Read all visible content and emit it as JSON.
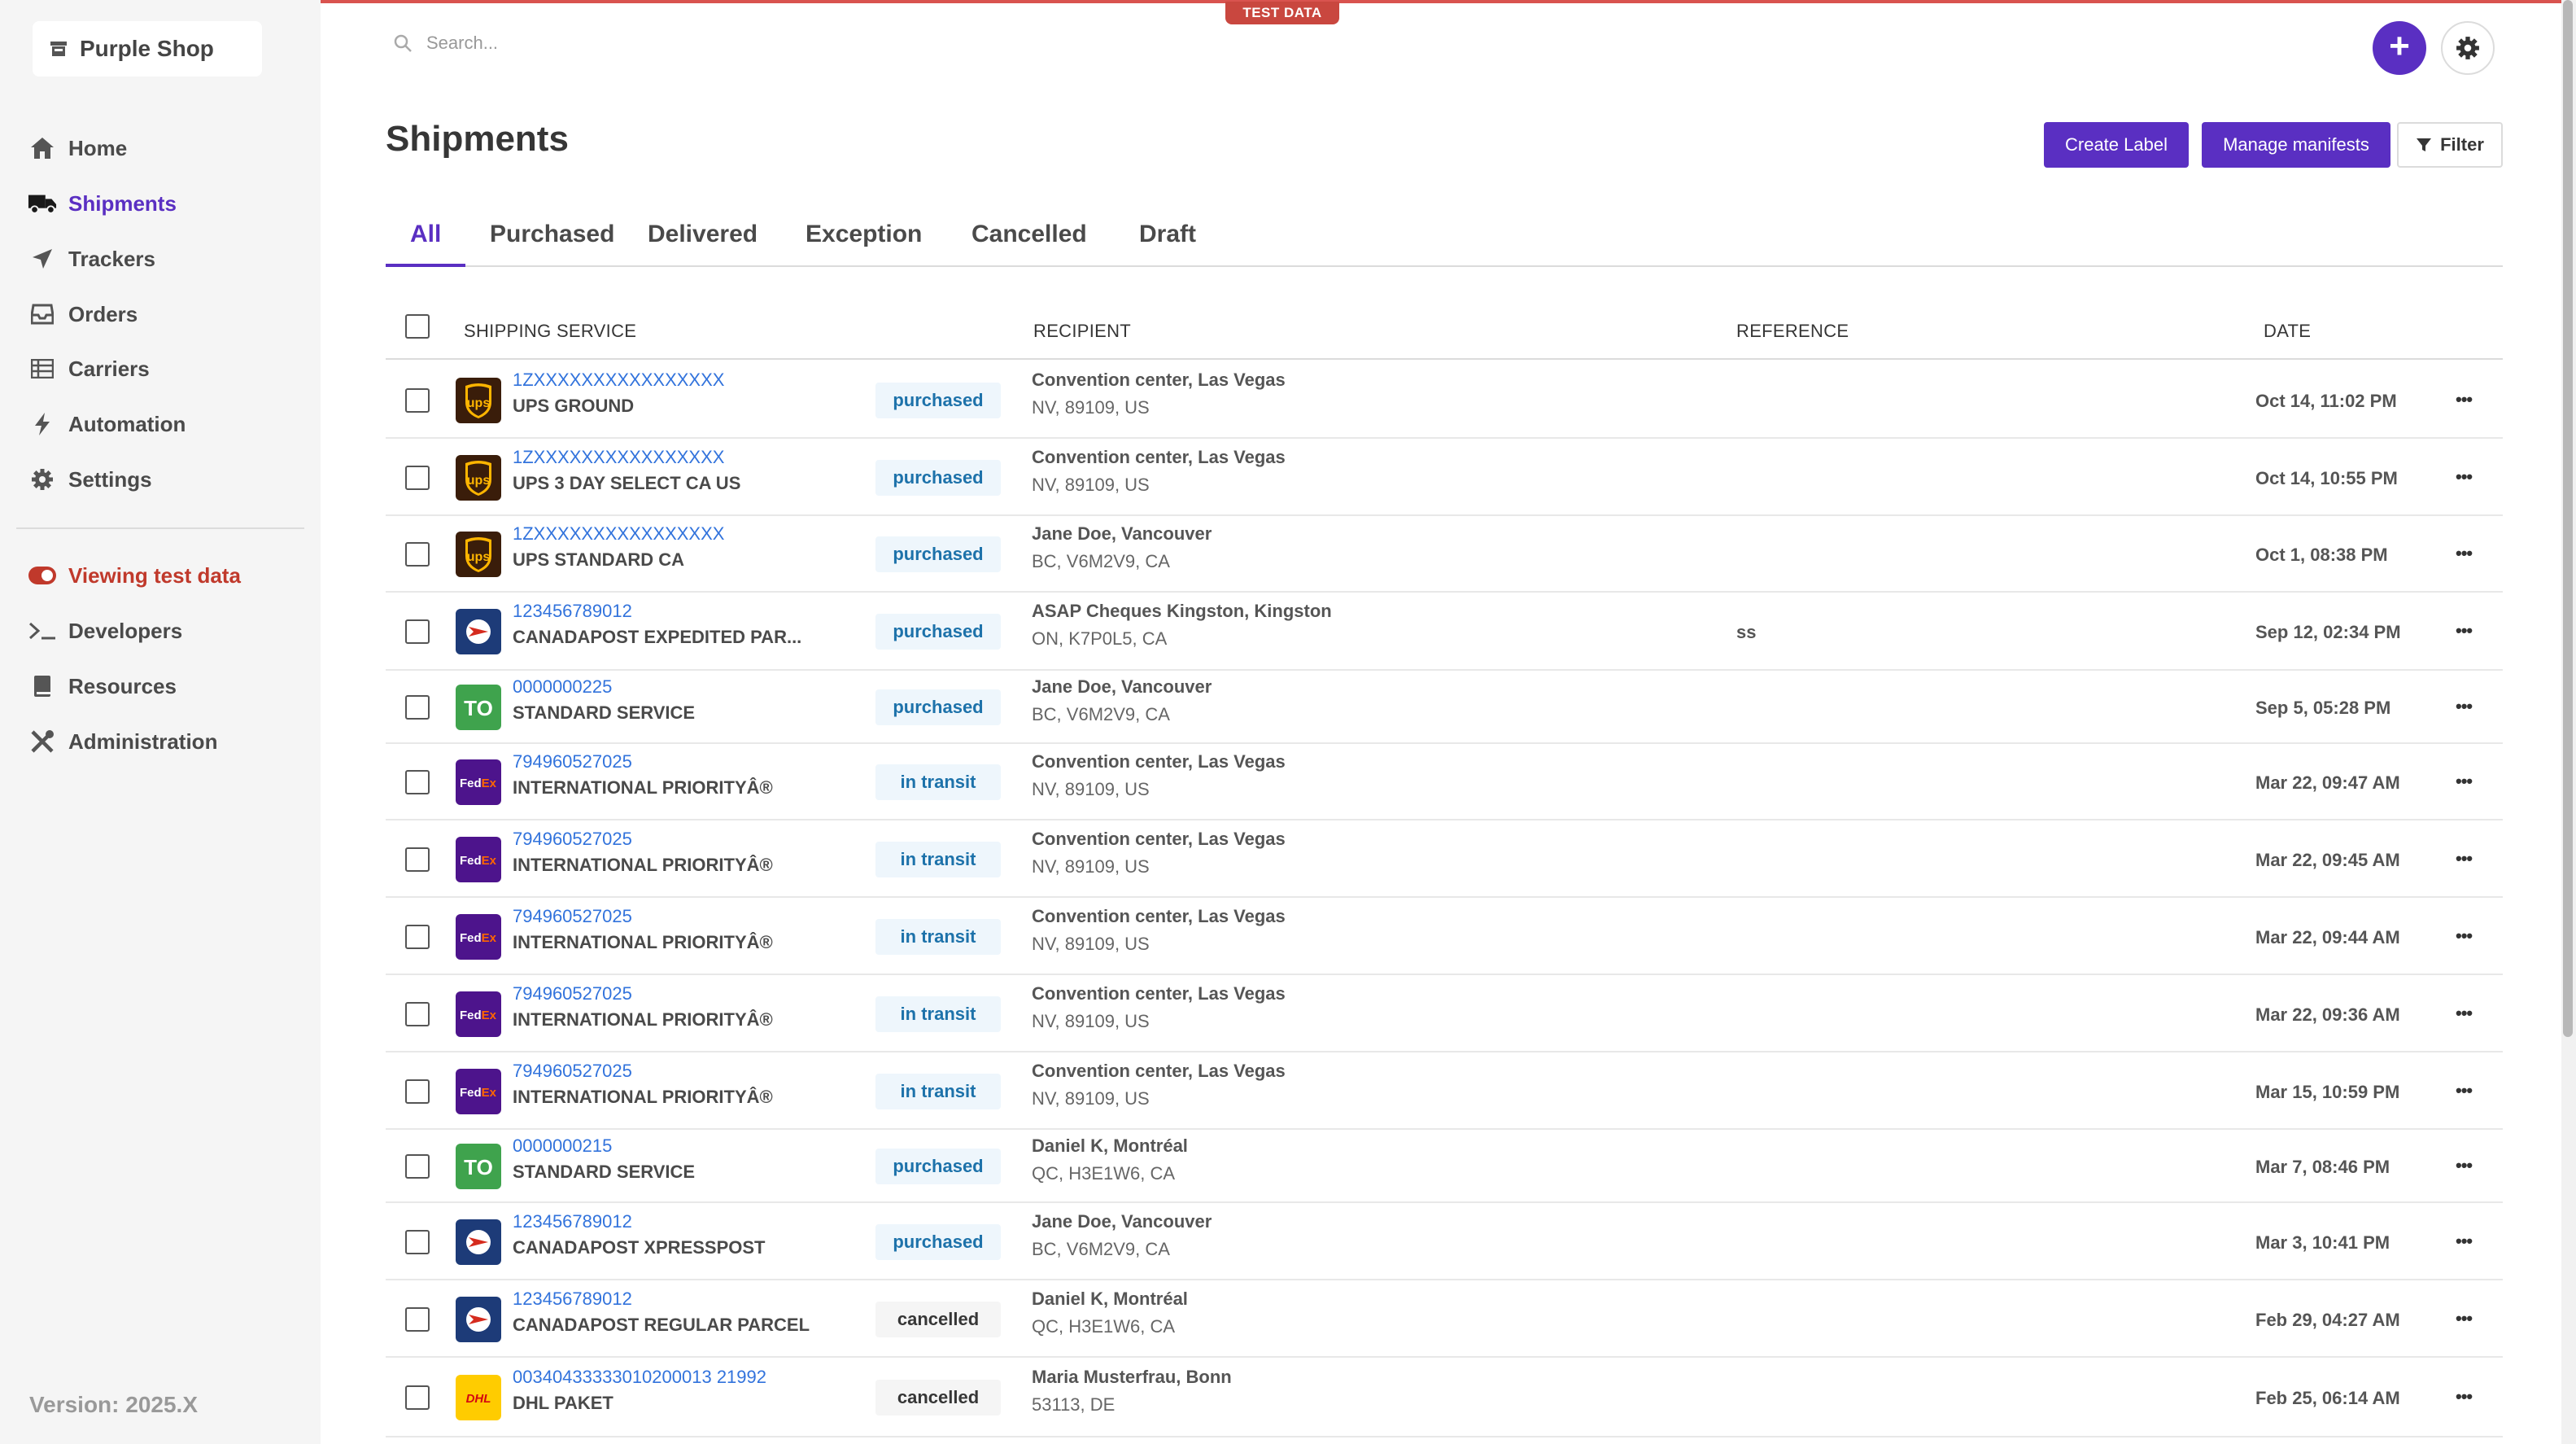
{
  "banner": {
    "test_badge": "TEST DATA"
  },
  "sidebar": {
    "shop_name": "Purple Shop",
    "items": [
      {
        "label": "Home",
        "icon": "home-icon"
      },
      {
        "label": "Shipments",
        "icon": "truck-icon",
        "active": true
      },
      {
        "label": "Trackers",
        "icon": "send-icon"
      },
      {
        "label": "Orders",
        "icon": "inbox-icon"
      },
      {
        "label": "Carriers",
        "icon": "list-icon"
      },
      {
        "label": "Automation",
        "icon": "bolt-icon"
      },
      {
        "label": "Settings",
        "icon": "gear-icon"
      }
    ],
    "test_mode_label": "Viewing test data",
    "items2": [
      {
        "label": "Developers",
        "icon": "terminal-icon"
      },
      {
        "label": "Resources",
        "icon": "book-icon"
      },
      {
        "label": "Administration",
        "icon": "tools-icon"
      }
    ],
    "version": "Version: 2025.X"
  },
  "search": {
    "placeholder": "Search..."
  },
  "header": {
    "title": "Shipments",
    "create_label": "Create Label",
    "manage_manifests": "Manage manifests",
    "filter": "Filter"
  },
  "tabs": [
    "All",
    "Purchased",
    "Delivered",
    "Exception",
    "Cancelled",
    "Draft"
  ],
  "table": {
    "columns": [
      "SHIPPING SERVICE",
      "RECIPIENT",
      "REFERENCE",
      "DATE"
    ],
    "rows": [
      {
        "carrier": "ups",
        "tracking": "1ZXXXXXXXXXXXXXXXX",
        "service": "UPS GROUND",
        "status": "purchased",
        "recipient": "Convention center, Las Vegas",
        "address": "NV, 89109, US",
        "reference": "",
        "date": "Oct 14, 11:02 PM"
      },
      {
        "carrier": "ups",
        "tracking": "1ZXXXXXXXXXXXXXXXX",
        "service": "UPS 3 DAY SELECT CA US",
        "status": "purchased",
        "recipient": "Convention center, Las Vegas",
        "address": "NV, 89109, US",
        "reference": "",
        "date": "Oct 14, 10:55 PM"
      },
      {
        "carrier": "ups",
        "tracking": "1ZXXXXXXXXXXXXXXXX",
        "service": "UPS STANDARD CA",
        "status": "purchased",
        "recipient": "Jane Doe, Vancouver",
        "address": "BC, V6M2V9, CA",
        "reference": "",
        "date": "Oct 1, 08:38 PM"
      },
      {
        "carrier": "canadapost",
        "tracking": "123456789012",
        "service": "CANADAPOST EXPEDITED PAR...",
        "status": "purchased",
        "recipient": "ASAP Cheques Kingston, Kingston",
        "address": "ON, K7P0L5, CA",
        "reference": "ss",
        "date": "Sep 12, 02:34 PM"
      },
      {
        "carrier": "to",
        "tracking": "0000000225",
        "service": "STANDARD SERVICE",
        "status": "purchased",
        "recipient": "Jane Doe, Vancouver",
        "address": "BC, V6M2V9, CA",
        "reference": "",
        "date": "Sep 5, 05:28 PM"
      },
      {
        "carrier": "fedex",
        "tracking": "794960527025",
        "service": "INTERNATIONAL PRIORITYÂ®",
        "status": "in transit",
        "recipient": "Convention center, Las Vegas",
        "address": "NV, 89109, US",
        "reference": "",
        "date": "Mar 22, 09:47 AM"
      },
      {
        "carrier": "fedex",
        "tracking": "794960527025",
        "service": "INTERNATIONAL PRIORITYÂ®",
        "status": "in transit",
        "recipient": "Convention center, Las Vegas",
        "address": "NV, 89109, US",
        "reference": "",
        "date": "Mar 22, 09:45 AM"
      },
      {
        "carrier": "fedex",
        "tracking": "794960527025",
        "service": "INTERNATIONAL PRIORITYÂ®",
        "status": "in transit",
        "recipient": "Convention center, Las Vegas",
        "address": "NV, 89109, US",
        "reference": "",
        "date": "Mar 22, 09:44 AM"
      },
      {
        "carrier": "fedex",
        "tracking": "794960527025",
        "service": "INTERNATIONAL PRIORITYÂ®",
        "status": "in transit",
        "recipient": "Convention center, Las Vegas",
        "address": "NV, 89109, US",
        "reference": "",
        "date": "Mar 22, 09:36 AM"
      },
      {
        "carrier": "fedex",
        "tracking": "794960527025",
        "service": "INTERNATIONAL PRIORITYÂ®",
        "status": "in transit",
        "recipient": "Convention center, Las Vegas",
        "address": "NV, 89109, US",
        "reference": "",
        "date": "Mar 15, 10:59 PM"
      },
      {
        "carrier": "to",
        "tracking": "0000000215",
        "service": "STANDARD SERVICE",
        "status": "purchased",
        "recipient": "Daniel K, Montréal",
        "address": "QC, H3E1W6, CA",
        "reference": "",
        "date": "Mar 7, 08:46 PM"
      },
      {
        "carrier": "canadapost",
        "tracking": "123456789012",
        "service": "CANADAPOST XPRESSPOST",
        "status": "purchased",
        "recipient": "Jane Doe, Vancouver",
        "address": "BC, V6M2V9, CA",
        "reference": "",
        "date": "Mar 3, 10:41 PM"
      },
      {
        "carrier": "canadapost",
        "tracking": "123456789012",
        "service": "CANADAPOST REGULAR PARCEL",
        "status": "cancelled",
        "recipient": "Daniel K, Montréal",
        "address": "QC, H3E1W6, CA",
        "reference": "",
        "date": "Feb 29, 04:27 AM"
      },
      {
        "carrier": "dhl",
        "tracking": "00340433333010200013 21992",
        "service": "DHL PAKET",
        "status": "cancelled",
        "recipient": "Maria Musterfrau, Bonn",
        "address": "53113, DE",
        "reference": "",
        "date": "Feb 25, 06:14 AM"
      }
    ]
  },
  "logos": {
    "ups": "ups",
    "to": "TO",
    "fedex_a": "Fed",
    "fedex_b": "Ex",
    "dhl": "DHL"
  },
  "more_glyph": "•••",
  "colors": {
    "accent": "#5a2fc2",
    "link": "#3273dc",
    "test": "#c9473f"
  }
}
